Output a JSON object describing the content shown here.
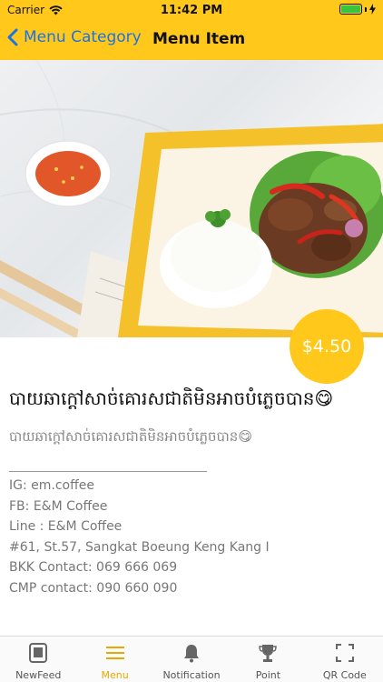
{
  "status_bar": {
    "carrier": "Carrier",
    "time": "11:42 PM"
  },
  "navbar": {
    "back_label": "Menu Category",
    "title": "Menu Item"
  },
  "item": {
    "price": "$4.50",
    "title": "បាយឆាក្តៅសាច់គោរសជាតិមិនអាចបំភ្លេចបាន😋",
    "description": "បាយឆាក្តៅសាច់គោរសជាតិមិនអាចបំភ្លេចបាន😋",
    "details": [
      "IG: em.coffee",
      "FB: E&M Coffee",
      "Line : E&M Coffee",
      "#61, St.57, Sangkat Boeung Keng Kang I",
      "BKK Contact: 069 666 069",
      "CMP contact: 090 660 090"
    ]
  },
  "tabs": [
    {
      "label": "NewFeed",
      "icon": "newsfeed-icon",
      "active": false
    },
    {
      "label": "Menu",
      "icon": "menu-icon",
      "active": true
    },
    {
      "label": "Notification",
      "icon": "bell-icon",
      "active": false
    },
    {
      "label": "Point",
      "icon": "trophy-icon",
      "active": false
    },
    {
      "label": "QR Code",
      "icon": "qr-scan-icon",
      "active": false
    }
  ],
  "colors": {
    "brand_yellow": "#FFC81A",
    "link_blue": "#1a73e8",
    "active_tab": "#E8A800"
  }
}
